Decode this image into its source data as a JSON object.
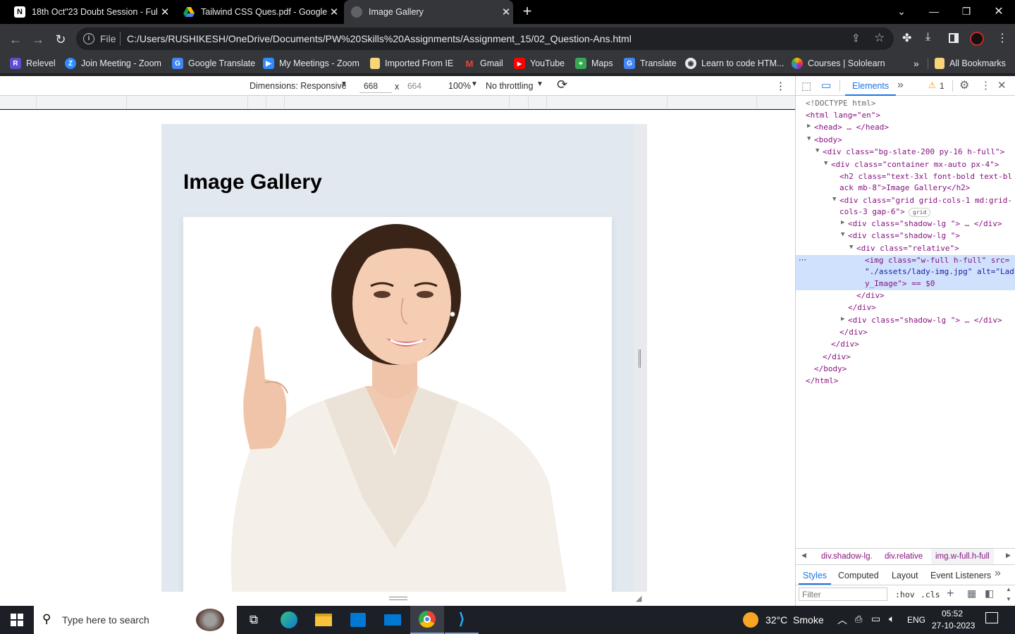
{
  "tabs": [
    {
      "title": "18th Oct\"23 Doubt Session - Ful"
    },
    {
      "title": "Tailwind CSS Ques.pdf - Google"
    },
    {
      "title": "Image Gallery"
    }
  ],
  "address_bar": {
    "scheme": "File",
    "url": "C:/Users/RUSHIKESH/OneDrive/Documents/PW%20Skills%20Assignments/Assignment_15/02_Question-Ans.html"
  },
  "bookmarks": [
    {
      "label": "Relevel"
    },
    {
      "label": "Join Meeting - Zoom"
    },
    {
      "label": "Google Translate"
    },
    {
      "label": "My Meetings - Zoom"
    },
    {
      "label": "Imported From IE"
    },
    {
      "label": "Gmail"
    },
    {
      "label": "YouTube"
    },
    {
      "label": "Maps"
    },
    {
      "label": "Translate"
    },
    {
      "label": "Learn to code HTM..."
    },
    {
      "label": "Courses | Sololearn"
    },
    {
      "label": "All Bookmarks"
    }
  ],
  "device_toolbar": {
    "dimensions": "Dimensions: Responsive",
    "width": "668",
    "times": "x",
    "height": "664",
    "zoom": "100%",
    "throttling": "No throttling"
  },
  "page": {
    "heading": "Image Gallery"
  },
  "devtools": {
    "tab_elements": "Elements",
    "warning_count": "1",
    "dom_lines": [
      "<!DOCTYPE html>",
      "<html lang=\"en\">",
      "<head> … </head>",
      "<body>",
      "<div class=\"bg-slate-200 py-16 h-full\">",
      "<div class=\"container mx-auto px-4\">",
      "<h2 class=\"text-3xl font-bold text-bl",
      "ack mb-8\">Image Gallery</h2>",
      "<div class=\"grid grid-cols-1 md:grid-",
      "cols-3 gap-6\">",
      "<div class=\"shadow-lg \"> … </div>",
      "<div class=\"shadow-lg \">",
      "<div class=\"relative\">",
      "<img class=\"w-full h-full\" src=",
      "\"./assets/lady-img.jpg\" alt=\"Lad",
      "y_Image\"> == $0",
      "</div>",
      "</div>",
      "<div class=\"shadow-lg \"> … </div>",
      "</div>",
      "</div>",
      "</div>",
      "</body>",
      "</html>"
    ],
    "grid_badge": "grid",
    "breadcrumbs": [
      "div.shadow-lg.",
      "div.relative",
      "img.w-full.h-full"
    ],
    "subtabs": [
      "Styles",
      "Computed",
      "Layout",
      "Event Listeners"
    ],
    "filter_placeholder": "Filter",
    "hov": ":hov",
    "cls": ".cls"
  },
  "taskbar": {
    "search_placeholder": "Type here to search",
    "weather": "32°C  Smoke",
    "lang": "ENG",
    "time": "05:52",
    "date": "27-10-2023"
  }
}
